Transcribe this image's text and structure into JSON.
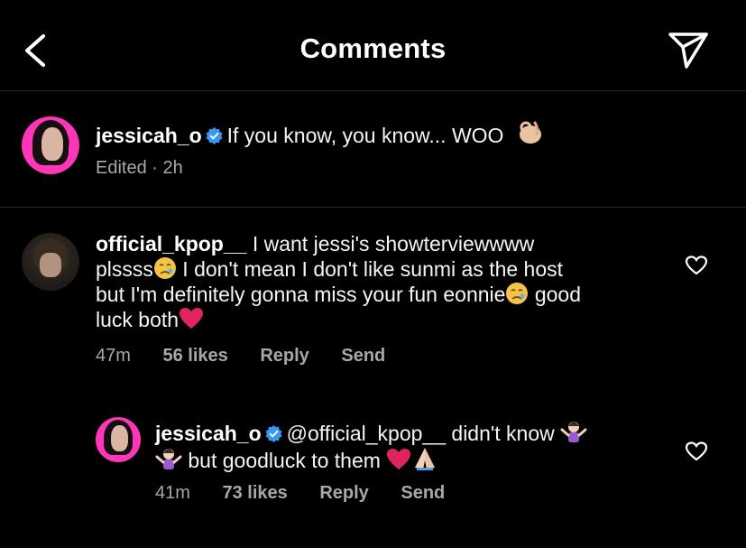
{
  "header": {
    "title": "Comments"
  },
  "caption": {
    "username": "jessicah_o",
    "text": "If you know, you know... WOO",
    "edited": "Edited · 2h"
  },
  "comments": [
    {
      "username": "official_kpop__",
      "text_parts": [
        "I want jessi's showterviewwww",
        "plssss",
        "I don't mean I don't like sunmi as the host",
        "but I'm definitely gonna miss your fun eonnie",
        "good",
        "luck both"
      ],
      "time": "47m",
      "likes": "56 likes",
      "reply": "Reply",
      "send": "Send"
    },
    {
      "username": "jessicah_o",
      "text_parts": [
        "@official_kpop__ didn't know",
        "but goodluck to them"
      ],
      "time": "41m",
      "likes": "73 likes",
      "reply": "Reply",
      "send": "Send"
    }
  ],
  "icons": {
    "back": "chevron-left-icon",
    "share": "paper-plane-icon",
    "verified": "verified-badge-icon",
    "like": "heart-outline-icon"
  },
  "colors": {
    "background": "#000000",
    "secondary_text": "#a8a8a8",
    "verified": "#3897f0",
    "heart_emoji": "#e0245e"
  }
}
